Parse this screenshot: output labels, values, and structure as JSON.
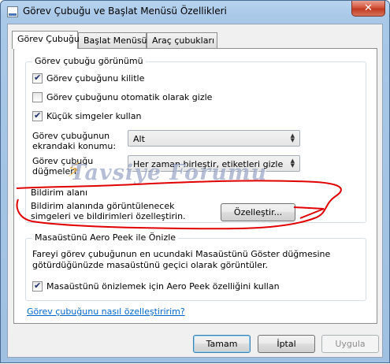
{
  "window": {
    "title": "Görev Çubuğu ve Başlat Menüsü Özellikleri",
    "close_glyph": "✕"
  },
  "tabs": [
    {
      "label": "Görev Çubuğu",
      "active": true
    },
    {
      "label": "Başlat Menüsü",
      "active": false
    },
    {
      "label": "Araç çubukları",
      "active": false
    }
  ],
  "appearance": {
    "legend": "Görev çubuğu görünümü",
    "lock": {
      "label": "Görev çubuğunu kilitle",
      "checked": true
    },
    "autohide": {
      "label": "Görev çubuğunu otomatik olarak gizle",
      "checked": false
    },
    "small_icons": {
      "label": "Küçük simgeler kullan",
      "checked": true
    },
    "location_label": "Görev çubuğunun ekrandaki konumu:",
    "location_value": "Alt",
    "buttons_label": "Görev çubuğu düğmeleri:",
    "buttons_value": "Her zaman birleştir, etiketleri gizle"
  },
  "notification": {
    "legend": "Bildirim alanı",
    "description": "Bildirim alanında görüntülenecek simgeleri ve bildirimleri özelleştirin.",
    "customize_button": "Özelleştir..."
  },
  "aero_peek": {
    "legend": "Masaüstünü Aero Peek ile Önizle",
    "description": "Fareyi görev çubuğunun en ucundaki Masaüstünü Göster düğmesine götürdüğünüzde masaüstünü geçici olarak görüntüler.",
    "checkbox": {
      "label": "Masaüstünü önizlemek için Aero Peek özelliğini kullan",
      "checked": true
    }
  },
  "help_link": "Görev çubuğunu nasıl özelleştiririm?",
  "footer": {
    "ok": "Tamam",
    "cancel": "İptal",
    "apply": "Uygula"
  },
  "watermark": "Tavsiye Forumu",
  "colors": {
    "annotation": "#e00000",
    "link": "#0066cc",
    "watermark": "#5a6ea0"
  }
}
